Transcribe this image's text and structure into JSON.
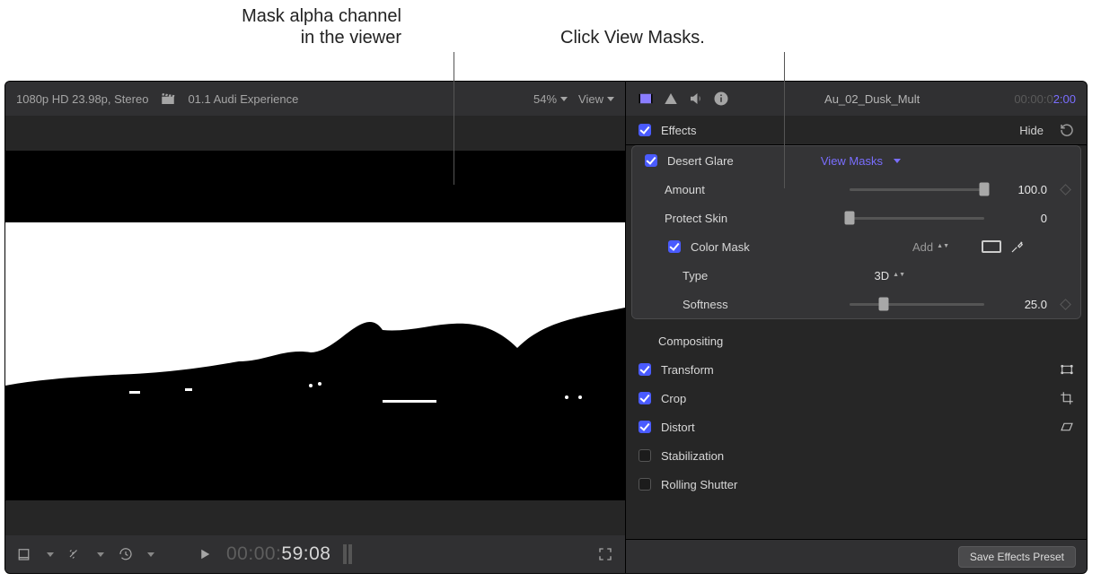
{
  "callouts": {
    "left": "Mask alpha channel\nin the viewer",
    "right": "Click View Masks."
  },
  "viewer": {
    "format": "1080p HD 23.98p, Stereo",
    "project": "01.1 Audi Experience",
    "zoom": "54%",
    "view_menu": "View",
    "timecode_dim": "00:00:",
    "timecode_bright": "59:08"
  },
  "inspector": {
    "clip_name": "Au_02_Dusk_Mult",
    "clip_tc_dim": "00:00:0",
    "clip_tc_bright": "2:00",
    "effects_label": "Effects",
    "hide_label": "Hide",
    "desert_glare": {
      "label": "Desert Glare",
      "view_masks": "View Masks",
      "amount_label": "Amount",
      "amount_value": "100.0",
      "protect_label": "Protect Skin",
      "protect_value": "0",
      "color_mask_label": "Color Mask",
      "add_label": "Add",
      "type_label": "Type",
      "type_value": "3D",
      "softness_label": "Softness",
      "softness_value": "25.0"
    },
    "sections": {
      "compositing": "Compositing",
      "transform": "Transform",
      "crop": "Crop",
      "distort": "Distort",
      "stabilization": "Stabilization",
      "rolling": "Rolling Shutter"
    },
    "save_preset": "Save Effects Preset"
  }
}
